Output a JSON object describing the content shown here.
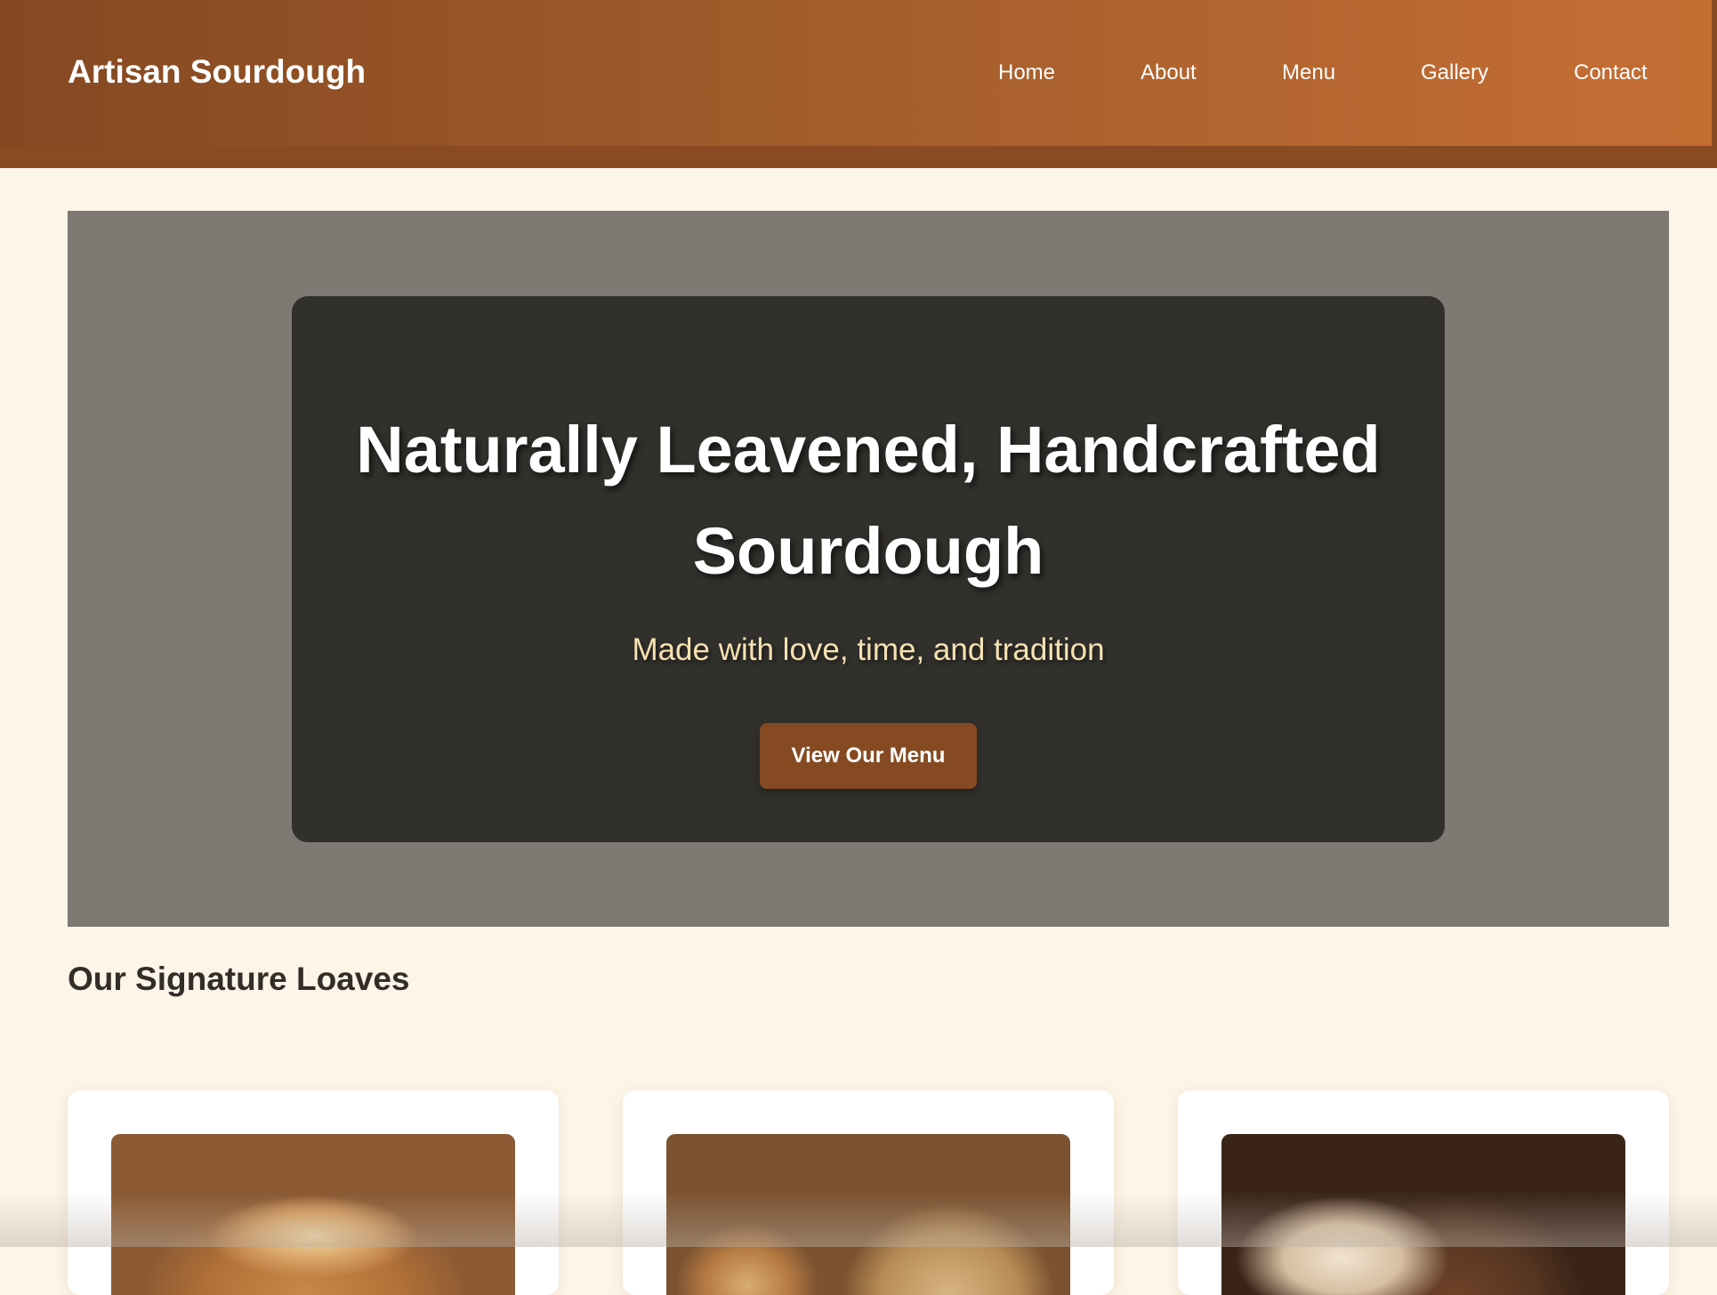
{
  "header": {
    "brand": "Artisan Sourdough",
    "nav": [
      "Home",
      "About",
      "Menu",
      "Gallery",
      "Contact"
    ]
  },
  "hero": {
    "title": "Naturally Leavened, Handcrafted Sourdough",
    "subtitle": "Made with love, time, and tradition",
    "cta_label": "View Our Menu"
  },
  "products": {
    "section_title": "Our Signature Loaves"
  },
  "colors": {
    "header_gradient_start": "#854821",
    "header_gradient_end": "#c56e34",
    "page_background": "#fdf5e8",
    "hero_overlay": "#32302c",
    "cta_button": "#854a22",
    "subtitle_text": "#f6e1b2"
  }
}
